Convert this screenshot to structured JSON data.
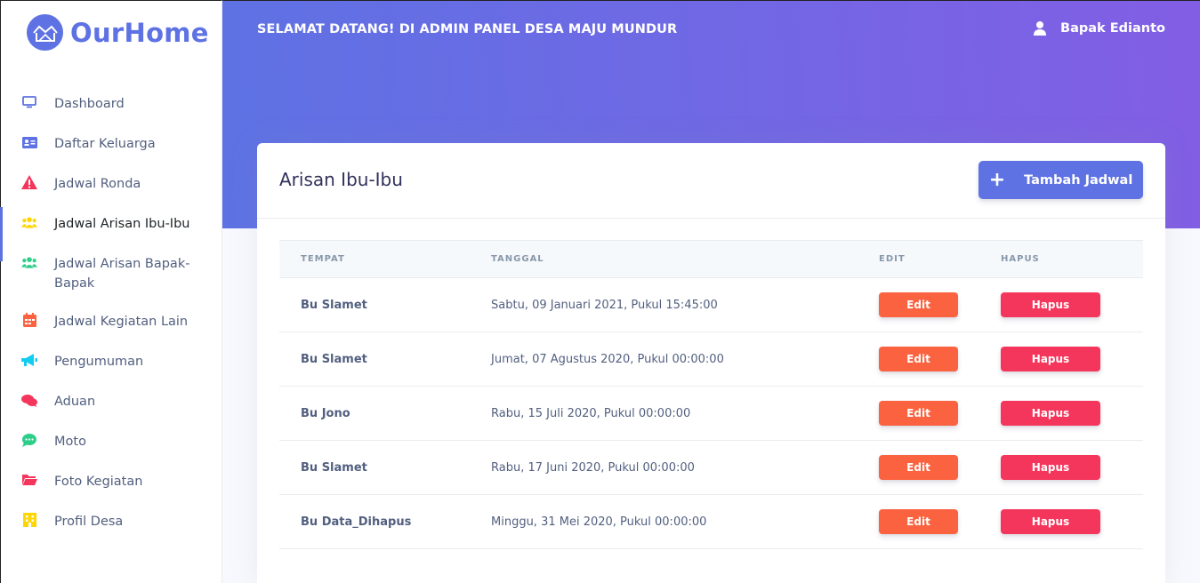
{
  "brand": {
    "name": "OurHome"
  },
  "sidebar": {
    "items": [
      {
        "label": "Dashboard",
        "icon": "monitor-icon",
        "color": "#5e72e4"
      },
      {
        "label": "Daftar Keluarga",
        "icon": "id-card-icon",
        "color": "#5e72e4"
      },
      {
        "label": "Jadwal Ronda",
        "icon": "warning-icon",
        "color": "#f5365c"
      },
      {
        "label": "Jadwal Arisan Ibu-Ibu",
        "icon": "users-icon",
        "color": "#ffd600",
        "active": true
      },
      {
        "label": "Jadwal Arisan Bapak-Bapak",
        "icon": "users-icon",
        "color": "#2dce89"
      },
      {
        "label": "Jadwal Kegiatan Lain",
        "icon": "calendar-icon",
        "color": "#fb6340"
      },
      {
        "label": "Pengumuman",
        "icon": "megaphone-icon",
        "color": "#11cdef"
      },
      {
        "label": "Aduan",
        "icon": "chat-icon",
        "color": "#f5365c"
      },
      {
        "label": "Moto",
        "icon": "comment-icon",
        "color": "#2dce89"
      },
      {
        "label": "Foto Kegiatan",
        "icon": "folder-icon",
        "color": "#f5365c"
      },
      {
        "label": "Profil Desa",
        "icon": "building-icon",
        "color": "#ffd600"
      }
    ]
  },
  "header": {
    "welcome": "SELAMAT DATANG! DI ADMIN PANEL DESA MAJU MUNDUR",
    "user_name": "Bapak Edianto"
  },
  "card": {
    "title": "Arisan Ibu-Ibu",
    "add_button": "Tambah Jadwal",
    "columns": [
      "TEMPAT",
      "TANGGAL",
      "EDIT",
      "HAPUS"
    ],
    "rows": [
      {
        "place": "Bu Slamet",
        "date": "Sabtu, 09 Januari 2021, Pukul 15:45:00",
        "edit": "Edit",
        "delete": "Hapus"
      },
      {
        "place": "Bu Slamet",
        "date": "Jumat, 07 Agustus 2020, Pukul 00:00:00",
        "edit": "Edit",
        "delete": "Hapus"
      },
      {
        "place": "Bu Jono",
        "date": "Rabu, 15 Juli 2020, Pukul 00:00:00",
        "edit": "Edit",
        "delete": "Hapus"
      },
      {
        "place": "Bu Slamet",
        "date": "Rabu, 17 Juni 2020, Pukul 00:00:00",
        "edit": "Edit",
        "delete": "Hapus"
      },
      {
        "place": "Bu Data_Dihapus",
        "date": "Minggu, 31 Mei 2020, Pukul 00:00:00",
        "edit": "Edit",
        "delete": "Hapus"
      }
    ]
  },
  "colors": {
    "primary": "#5e72e4",
    "gradient_end": "#825ee4",
    "warning": "#fb6340",
    "danger": "#f5365c"
  }
}
